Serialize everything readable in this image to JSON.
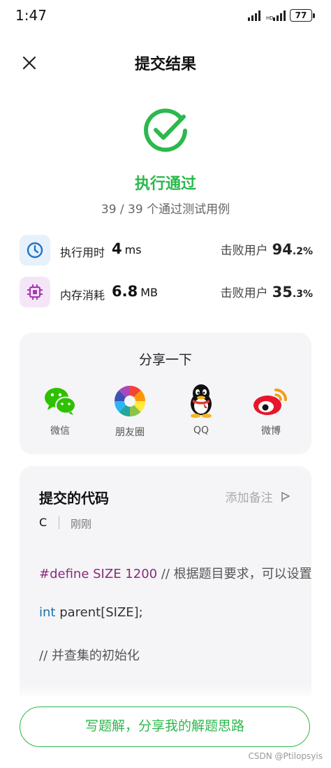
{
  "status_bar": {
    "time": "1:47",
    "battery": "77"
  },
  "header": {
    "title": "提交结果",
    "close_icon": "close-icon"
  },
  "result": {
    "status": "执行通过",
    "cases": "39 / 39 个通过测试用例",
    "accent": "#2db84d"
  },
  "stats": {
    "runtime": {
      "label": "执行用时",
      "value": "4",
      "unit": "ms",
      "beat_label": "击败用户",
      "beat_int": "94",
      "beat_dec": ".2%"
    },
    "memory": {
      "label": "内存消耗",
      "value": "6.8",
      "unit": "MB",
      "beat_label": "击败用户",
      "beat_int": "35",
      "beat_dec": ".3%"
    }
  },
  "share": {
    "title": "分享一下",
    "items": [
      {
        "label": "微信",
        "icon": "wechat-icon"
      },
      {
        "label": "朋友圈",
        "icon": "moments-icon"
      },
      {
        "label": "QQ",
        "icon": "qq-icon"
      },
      {
        "label": "微博",
        "icon": "weibo-icon"
      }
    ]
  },
  "code": {
    "title": "提交的代码",
    "note": "添加备注",
    "language": "C",
    "time_ago": "刚刚",
    "lines": [
      {
        "kw": "#define",
        "name": " SIZE ",
        "num": "1200",
        "comment": "  // 根据题目要求，可以设置"
      },
      {
        "type": "int",
        "rest": " parent[SIZE];"
      },
      {
        "comment": "// 并查集的初始化"
      }
    ]
  },
  "footer": {
    "button": "写题解，分享我的解题思路",
    "watermark": "CSDN @Ptilopsyis"
  }
}
